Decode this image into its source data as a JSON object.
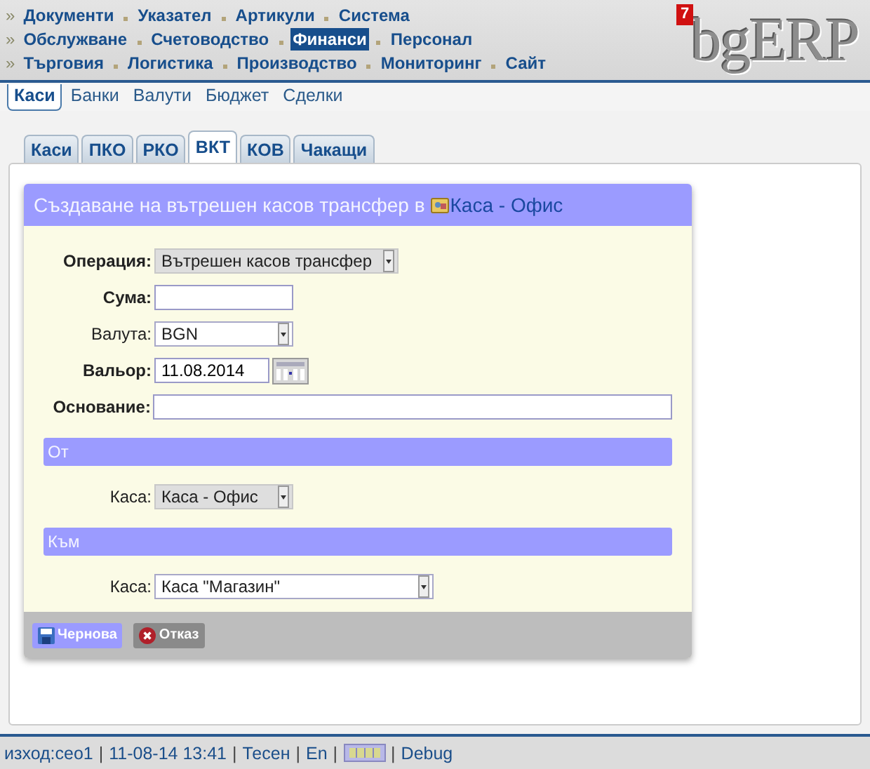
{
  "menu": {
    "rows": [
      {
        "bullet": "»",
        "items": [
          {
            "label": "Документи",
            "selected": false
          },
          {
            "label": "Указател",
            "selected": false
          },
          {
            "label": "Артикули",
            "selected": false
          },
          {
            "label": "Система",
            "selected": false
          }
        ]
      },
      {
        "bullet": "»",
        "items": [
          {
            "label": "Обслужване",
            "selected": false
          },
          {
            "label": "Счетоводство",
            "selected": false
          },
          {
            "label": "Финанси",
            "selected": true
          },
          {
            "label": "Персонал",
            "selected": false
          }
        ]
      },
      {
        "bullet": "»",
        "items": [
          {
            "label": "Търговия",
            "selected": false
          },
          {
            "label": "Логистика",
            "selected": false
          },
          {
            "label": "Производство",
            "selected": false
          },
          {
            "label": "Мониторинг",
            "selected": false
          },
          {
            "label": "Сайт",
            "selected": false
          }
        ]
      }
    ]
  },
  "logo": {
    "text": "bgERP",
    "badge": "7"
  },
  "subnav": [
    {
      "label": "Каси",
      "selected": true
    },
    {
      "label": "Банки",
      "selected": false
    },
    {
      "label": "Валути",
      "selected": false
    },
    {
      "label": "Бюджет",
      "selected": false
    },
    {
      "label": "Сделки",
      "selected": false
    }
  ],
  "tabs": [
    {
      "label": "Каси",
      "selected": false
    },
    {
      "label": "ПКО",
      "selected": false
    },
    {
      "label": "РКО",
      "selected": false
    },
    {
      "label": "ВКТ",
      "selected": true
    },
    {
      "label": "КОВ",
      "selected": false
    },
    {
      "label": "Чакащи",
      "selected": false
    }
  ],
  "form": {
    "title": "Създаване на вътрешен касов трансфер в",
    "title_link": "Каса - Офис",
    "rows": [
      {
        "kind": "select",
        "label": "Операция:",
        "bold": true,
        "value": "Вътрешен касов трансфер",
        "disabled": true
      },
      {
        "kind": "text",
        "label": "Сума:",
        "bold": true
      },
      {
        "kind": "select",
        "label": "Валута:",
        "bold": false,
        "value": "BGN",
        "disabled": false
      },
      {
        "kind": "date",
        "label": "Вальор:",
        "bold": true,
        "value": "11.08.2014"
      },
      {
        "kind": "text",
        "label": "Основание:",
        "bold": true
      },
      {
        "kind": "section",
        "label": "От"
      },
      {
        "kind": "select",
        "label": "Каса:",
        "bold": false,
        "value": "Каса - Офис",
        "disabled": true
      },
      {
        "kind": "section",
        "label": "Към"
      },
      {
        "kind": "select",
        "label": "Каса:",
        "bold": false,
        "value": "Каса \"Магазин\"",
        "disabled": false
      }
    ],
    "buttons": [
      {
        "label": "Чернова",
        "kind": "save"
      },
      {
        "label": "Отказ",
        "kind": "cancel"
      }
    ]
  },
  "status_bar": [
    {
      "kind": "link",
      "label": "изход:сео1"
    },
    {
      "kind": "separator",
      "label": "|"
    },
    {
      "kind": "text",
      "label": "11-08-14 13:41"
    },
    {
      "kind": "separator",
      "label": "|"
    },
    {
      "kind": "link",
      "label": "Тесен"
    },
    {
      "kind": "separator",
      "label": "|"
    },
    {
      "kind": "link",
      "label": "En"
    },
    {
      "kind": "separator",
      "label": "|"
    },
    {
      "kind": "icon"
    },
    {
      "kind": "separator",
      "label": "|"
    },
    {
      "kind": "link",
      "label": "Debug"
    }
  ]
}
